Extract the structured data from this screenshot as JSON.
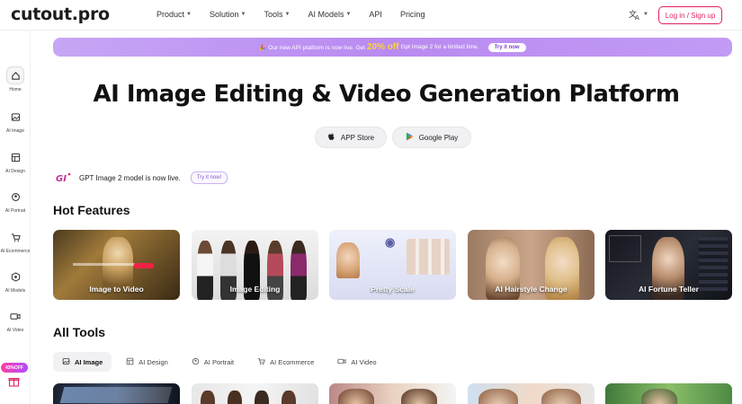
{
  "app": {
    "logo": "cutout.pro"
  },
  "nav": {
    "items": [
      {
        "label": "Product",
        "has_caret": true
      },
      {
        "label": "Solution",
        "has_caret": true
      },
      {
        "label": "Tools",
        "has_caret": true
      },
      {
        "label": "AI Models",
        "has_caret": true
      },
      {
        "label": "API",
        "has_caret": false
      },
      {
        "label": "Pricing",
        "has_caret": false
      }
    ],
    "language_icon": "translate-icon",
    "login_label": "Log in / Sign up"
  },
  "sidebar": {
    "items": [
      {
        "label": "Home",
        "icon": "home-icon"
      },
      {
        "label": "AI Image",
        "icon": "image-icon"
      },
      {
        "label": "AI Design",
        "icon": "design-icon"
      },
      {
        "label": "AI Portrait",
        "icon": "portrait-icon"
      },
      {
        "label": "AI Ecommerce",
        "icon": "cart-icon"
      },
      {
        "label": "AI Models",
        "icon": "models-icon"
      },
      {
        "label": "AI Video",
        "icon": "video-icon"
      }
    ],
    "off_badge": "43%OFF",
    "gift_icon": "gift-icon"
  },
  "banner": {
    "text_before": "🎉 Our new API platform is now live. Get",
    "highlight": "20% off",
    "text_after": "Gpt Image 2 for a limited time.",
    "cta": "Try it now"
  },
  "hero": {
    "title": "AI Image Editing & Video Generation Platform",
    "app_store": "APP Store",
    "google_play": "Google Play"
  },
  "gpt_notice": {
    "text": "GPT Image 2 model is now live.",
    "cta": "Try it now!"
  },
  "hot_features": {
    "title": "Hot Features",
    "cards": [
      {
        "label": "Image to Video"
      },
      {
        "label": "Image Editing"
      },
      {
        "label": "Pretty Scale"
      },
      {
        "label": "AI Hairstyle Change"
      },
      {
        "label": "AI Fortune Teller"
      }
    ]
  },
  "all_tools": {
    "title": "All Tools",
    "tabs": [
      {
        "label": "AI Image",
        "icon": "image-icon",
        "active": true
      },
      {
        "label": "AI Design",
        "icon": "design-icon",
        "active": false
      },
      {
        "label": "AI Portrait",
        "icon": "portrait-icon",
        "active": false
      },
      {
        "label": "AI Ecommerce",
        "icon": "cart-icon",
        "active": false
      },
      {
        "label": "AI Video",
        "icon": "video-icon",
        "active": false
      }
    ]
  },
  "colors": {
    "accent": "#e0245e",
    "banner": "#b98af0"
  }
}
